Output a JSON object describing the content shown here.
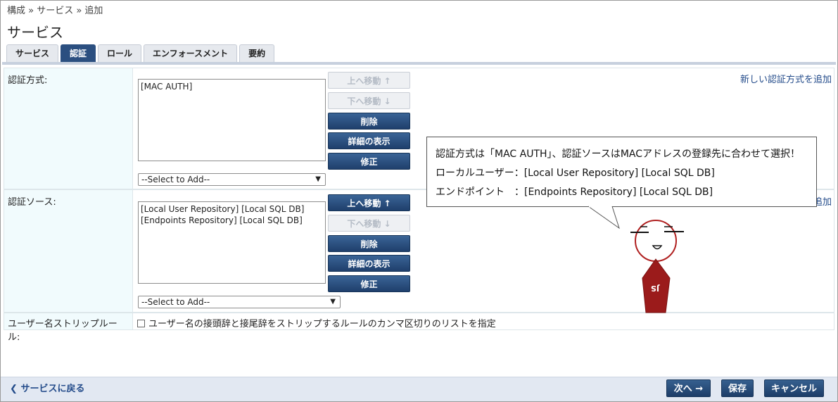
{
  "breadcrumb": "構成 » サービス » 追加",
  "page_title": "サービス",
  "tabs": [
    {
      "label": "サービス",
      "active": false
    },
    {
      "label": "認証",
      "active": true
    },
    {
      "label": "ロール",
      "active": false
    },
    {
      "label": "エンフォースメント",
      "active": false
    },
    {
      "label": "要約",
      "active": false
    }
  ],
  "auth_methods": {
    "label": "認証方式:",
    "items": [
      "[MAC AUTH]"
    ],
    "select": "--Select to Add--",
    "add_link": "新しい認証方式を追加",
    "buttons": {
      "up": "上へ移動 ↑",
      "down": "下へ移動 ↓",
      "remove": "削除",
      "details": "詳細の表示",
      "modify": "修正"
    }
  },
  "auth_sources": {
    "label": "認証ソース:",
    "items": [
      "[Local User Repository] [Local SQL DB]",
      "[Endpoints Repository] [Local SQL DB]"
    ],
    "select": "--Select to Add--",
    "add_link_fragment": "追加",
    "buttons": {
      "up": "上へ移動 ↑",
      "down": "下へ移動 ↓",
      "remove": "削除",
      "details": "詳細の表示",
      "modify": "修正"
    }
  },
  "strip_rules": {
    "label": "ユーザー名ストリップルール:",
    "checkbox_label": "ユーザー名の接頭辞と接尾辞をストリップするルールのカンマ区切りのリストを指定",
    "checked": false
  },
  "callout": {
    "line1": "認証方式は「MAC AUTH」、認証ソースはMACアドレスの登録先に合わせて選択！",
    "line2": "ローカルユーザー：[Local User Repository] [Local SQL DB]",
    "line3": "エンドポイント　：[Endpoints Repository] [Local SQL DB]"
  },
  "mascot_badge": "JS",
  "footer": {
    "back": "サービスに戻る",
    "next": "次へ →",
    "save": "保存",
    "cancel": "キャンセル"
  },
  "colors": {
    "accent": "#2b4f80",
    "link": "#234b8a",
    "mascot_body": "#9b1b1b"
  }
}
